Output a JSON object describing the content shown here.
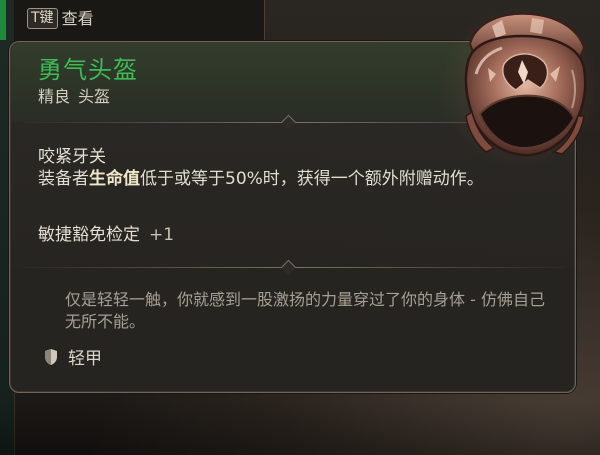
{
  "hint": {
    "key": "T键",
    "action": "查看"
  },
  "item": {
    "name": "勇气头盔",
    "rarity": "精良",
    "type": "头盔",
    "name_color": "#3cbc55",
    "icon": "helmet-icon"
  },
  "passive": {
    "title": "咬紧牙关",
    "desc_before": "装备者",
    "desc_highlight": "生命值",
    "desc_after": "低于或等于50%时，获得一个额外附赠动作。"
  },
  "stat": {
    "label": "敏捷豁免检定",
    "bonus": "+1"
  },
  "flavor": "仅是轻轻一触，你就感到一股激扬的力量穿过了你的身体 - 仿佛自己无所不能。",
  "armor": {
    "label": "轻甲",
    "icon": "shield-icon"
  }
}
